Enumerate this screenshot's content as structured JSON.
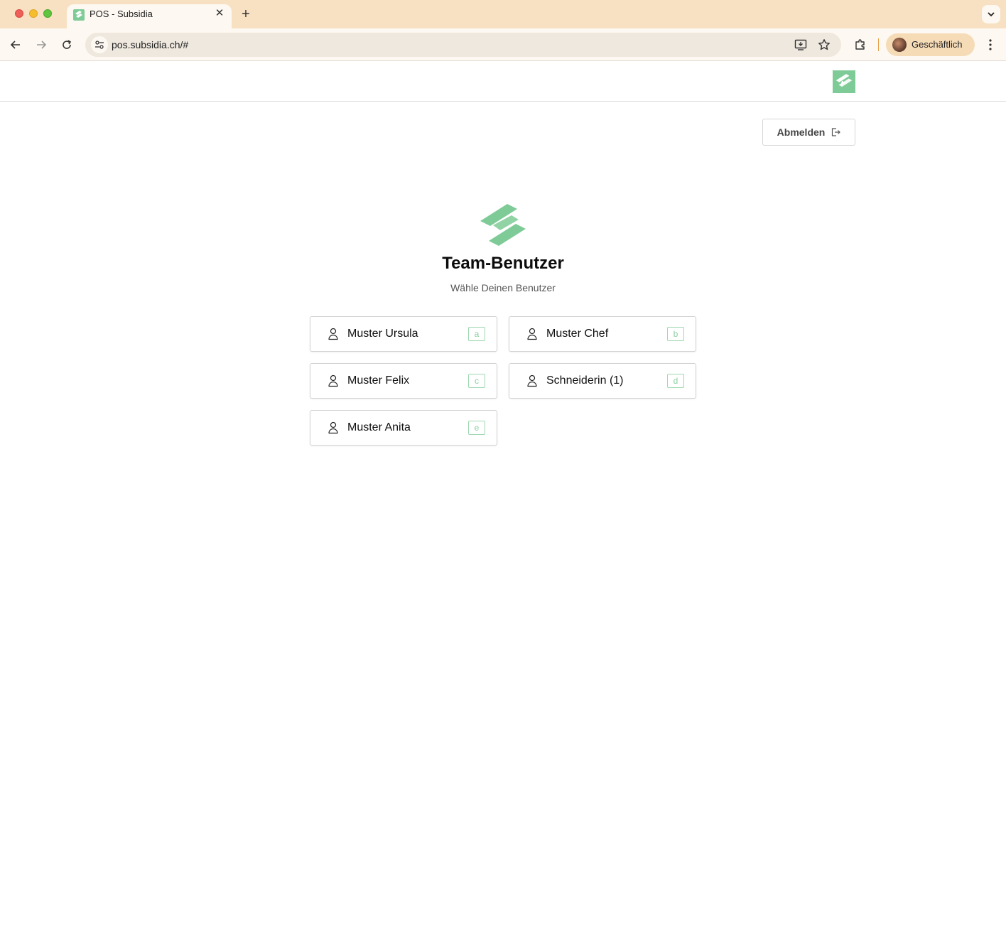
{
  "browser": {
    "tab_title": "POS - Subsidia",
    "tab_close": "✕",
    "new_tab": "+",
    "url": "pos.subsidia.ch/#",
    "profile_name": "Geschäftlich"
  },
  "page": {
    "logout_label": "Abmelden",
    "title": "Team-Benutzer",
    "subtitle": "Wähle Deinen Benutzer",
    "brand_color": "#7fcb97",
    "users": [
      {
        "name": "Muster Ursula",
        "shortcut": "a"
      },
      {
        "name": "Muster Chef",
        "shortcut": "b"
      },
      {
        "name": "Muster Felix",
        "shortcut": "c"
      },
      {
        "name": "Schneiderin (1)",
        "shortcut": "d"
      },
      {
        "name": "Muster Anita",
        "shortcut": "e"
      }
    ]
  }
}
